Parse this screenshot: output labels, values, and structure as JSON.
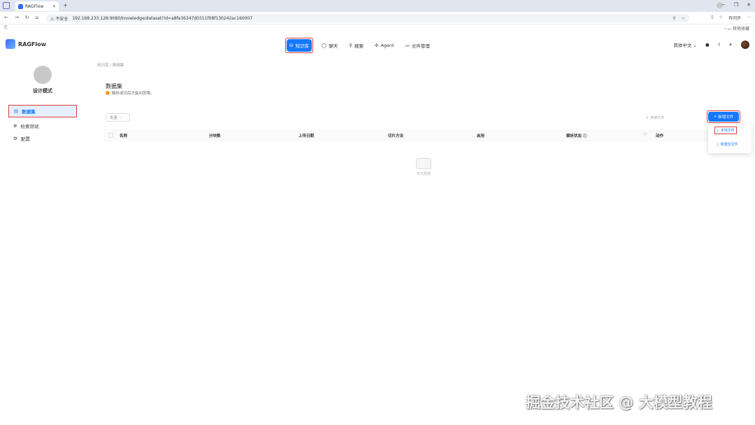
{
  "browser": {
    "tab_title": "RAGFlow",
    "new_tab": "+",
    "url_warning": "不安全",
    "url": "192.168.233.128:9080/knowledge/dataset?id=a8fe36347d0311f08f130242ac160007",
    "profile_label": "有同步",
    "bookmarks_right": "其他收藏"
  },
  "header": {
    "logo": "RAGFlow",
    "nav": [
      {
        "label": "知识库"
      },
      {
        "label": "聊天"
      },
      {
        "label": "搜索"
      },
      {
        "label": "Agent"
      },
      {
        "label": "文件管理"
      }
    ],
    "language": "简体中文"
  },
  "sidebar": {
    "kb_name": "设计模式",
    "items": [
      {
        "label": "数据集"
      },
      {
        "label": "检索测试"
      },
      {
        "label": "配置"
      }
    ]
  },
  "main": {
    "breadcrumb_root": "知识库",
    "breadcrumb_sep": "/",
    "breadcrumb_current": "数据集",
    "title": "数据集",
    "subtitle": "解析成功后才能问答哦。",
    "bulk_label": "批量",
    "search_placeholder": "搜索文件",
    "add_file_label": "新增文件",
    "columns": [
      "名称",
      "分块数",
      "上传日期",
      "切片方法",
      "启用",
      "解析状态",
      "动作"
    ],
    "empty_text": "暂无数据",
    "dropdown": {
      "local_file": "本地文件",
      "empty_file": "新建空文件"
    }
  },
  "watermark": "掘金技术社区 @ 大模型教程",
  "colors": {
    "accent": "#1677ff",
    "highlight_box": "#e03b3b"
  }
}
